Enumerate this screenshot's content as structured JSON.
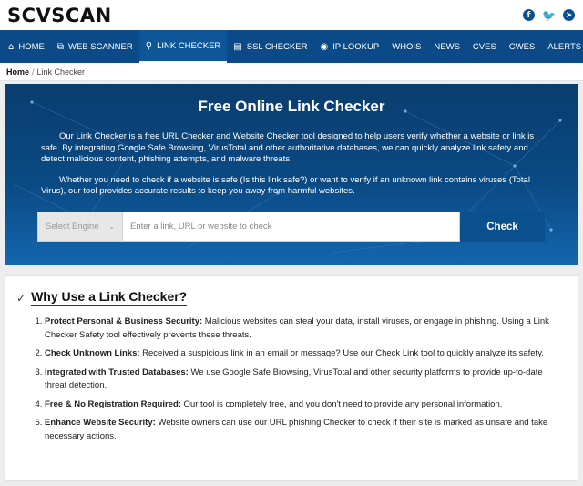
{
  "brand": {
    "logo": "SCVSCAN"
  },
  "social": [
    {
      "icon": "facebook-icon",
      "glyph": "f"
    },
    {
      "icon": "twitter-icon",
      "glyph": "🐦"
    },
    {
      "icon": "telegram-icon",
      "glyph": "➤"
    }
  ],
  "nav": [
    {
      "label": "HOME",
      "icon": "home-icon",
      "glyph": "⌂"
    },
    {
      "label": "WEB SCANNER",
      "icon": "scanner-icon",
      "glyph": "⧉"
    },
    {
      "label": "LINK CHECKER",
      "icon": "search-icon",
      "glyph": "⚲",
      "active": true
    },
    {
      "label": "SSL CHECKER",
      "icon": "certificate-icon",
      "glyph": "▤"
    },
    {
      "label": "IP LOOKUP",
      "icon": "location-pin-icon",
      "glyph": "◉"
    },
    {
      "label": "WHOIS"
    },
    {
      "label": "NEWS"
    },
    {
      "label": "CVES"
    },
    {
      "label": "CWES"
    },
    {
      "label": "ALERTS"
    },
    {
      "label": "•••"
    }
  ],
  "breadcrumb": {
    "home": "Home",
    "separator": "/",
    "current": "Link Checker"
  },
  "hero": {
    "title": "Free Online Link Checker",
    "p1": "Our Link Checker is a free URL Checker and Website Checker tool designed to help users verify whether a website or link is safe. By integrating Google Safe Browsing, VirusTotal and other authoritative databases, we can quickly analyze link safety and detect malicious content, phishing attempts, and malware threats.",
    "p2": "Whether you need to check if a website is safe (Is this link safe?) or want to verify if an unknown link contains viruses (Total Virus), our tool provides accurate results to keep you away from harmful websites."
  },
  "search": {
    "engine_placeholder": "Select Engine",
    "query_placeholder": "Enter a link, URL or website to check",
    "button_label": "Check"
  },
  "why": {
    "title": "Why Use a Link Checker?",
    "items": [
      {
        "heading": "Protect Personal & Business Security:",
        "text": " Malicious websites can steal your data, install viruses, or engage in phishing. Using a Link Checker Safety tool effectively prevents these threats."
      },
      {
        "heading": "Check Unknown Links:",
        "text": " Received a suspicious link in an email or message? Use our Check Link tool to quickly analyze its safety."
      },
      {
        "heading": "Integrated with Trusted Databases:",
        "text": " We use Google Safe Browsing, VirusTotal and other security platforms to provide up-to-date threat detection."
      },
      {
        "heading": "Free & No Registration Required:",
        "text": " Our tool is completely free, and you don't need to provide any personal information."
      },
      {
        "heading": "Enhance Website Security:",
        "text": " Website owners can use our URL phishing Checker to check if their site is marked as unsafe and take necessary actions."
      }
    ]
  }
}
